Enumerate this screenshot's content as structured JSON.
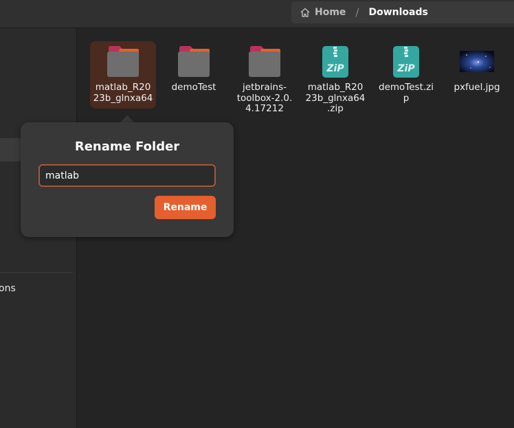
{
  "breadcrumb": {
    "home_label": "Home",
    "current_label": "Downloads",
    "separator": "/"
  },
  "sidebar": {
    "partial_item_label": "ons"
  },
  "files": [
    {
      "name": "matlab_R2023b_glnxa64",
      "display": "matlab_R20\n23b_glnxa64",
      "type": "folder",
      "icon": "folder-icon",
      "selected": true
    },
    {
      "name": "demoTest",
      "display": "demoTest",
      "type": "folder",
      "icon": "folder-icon",
      "selected": false
    },
    {
      "name": "jetbrains-toolbox-2.0.4.17212",
      "display": "jetbrains-\ntoolbox-2.0.\n4.17212",
      "type": "folder",
      "icon": "folder-icon",
      "selected": false
    },
    {
      "name": "matlab_R2023b_glnxa64.zip",
      "display": "matlab_R20\n23b_glnxa64\n.zip",
      "type": "zip",
      "icon": "zip-archive-icon",
      "selected": false
    },
    {
      "name": "demoTest.zip",
      "display": "demoTest.zi\np",
      "type": "zip",
      "icon": "zip-archive-icon",
      "selected": false
    },
    {
      "name": "pxfuel.jpg",
      "display": "pxfuel.jpg",
      "type": "image",
      "icon": "image-thumbnail-icon",
      "selected": false
    }
  ],
  "rename_popover": {
    "title": "Rename Folder",
    "entry_value": "matlab",
    "button_label": "Rename"
  },
  "colors": {
    "accent": "#e5602e",
    "selection_bg": "#4b2a20",
    "entry_border": "#a9573a",
    "zip_teal": "#35a7a1",
    "folder_tab_magenta": "#b8335a",
    "folder_tab_orange": "#e5602e"
  }
}
